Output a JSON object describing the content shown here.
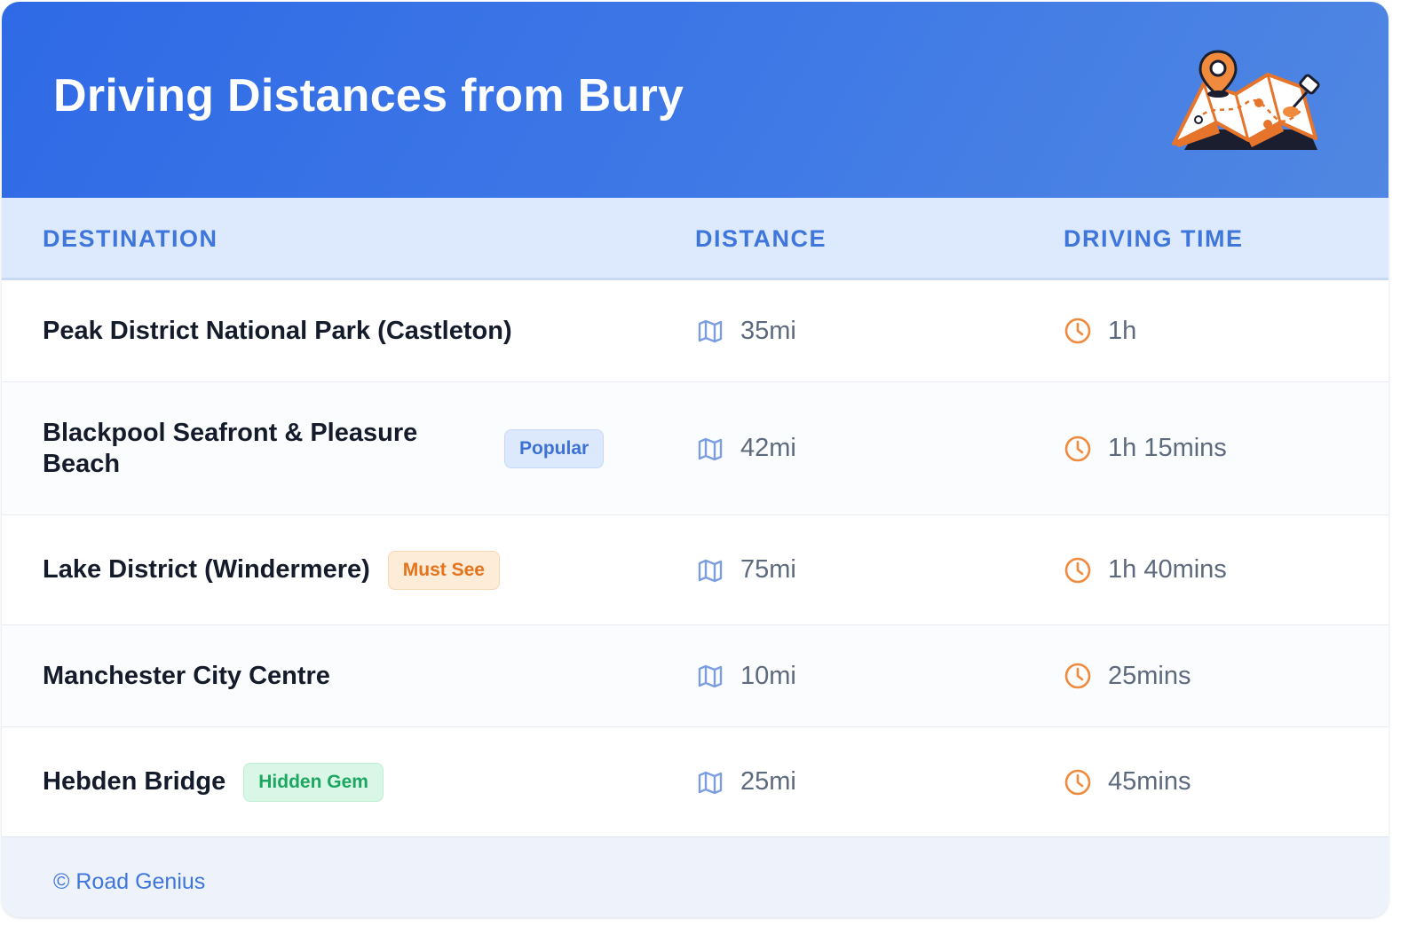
{
  "header": {
    "title": "Driving Distances from Bury"
  },
  "table": {
    "columns": {
      "destination": "DESTINATION",
      "distance": "DISTANCE",
      "driving_time": "DRIVING TIME"
    },
    "rows": [
      {
        "destination": "Peak District National Park (Castleton)",
        "badge": "",
        "distance": "35mi",
        "time": "1h"
      },
      {
        "destination": "Blackpool Seafront & Pleasure Beach",
        "badge": "Popular",
        "distance": "42mi",
        "time": "1h 15mins"
      },
      {
        "destination": "Lake District (Windermere)",
        "badge": "Must See",
        "distance": "75mi",
        "time": "1h 40mins"
      },
      {
        "destination": "Manchester City Centre",
        "badge": "",
        "distance": "10mi",
        "time": "25mins"
      },
      {
        "destination": "Hebden Bridge",
        "badge": "Hidden Gem",
        "distance": "25mi",
        "time": "45mins"
      }
    ]
  },
  "footer": {
    "credit": "© Road Genius"
  },
  "colors": {
    "header_start": "#2f6ae6",
    "header_end": "#5087e2",
    "accent_blue": "#3f76db",
    "icon_orange": "#f08a3c",
    "popular_badge": "#dce9fd",
    "must_see_badge": "#fdecd8",
    "hidden_gem_badge": "#d9f6e6"
  },
  "icons": {
    "header": "map-with-pins-icon",
    "distance": "map-icon",
    "time": "clock-icon"
  }
}
